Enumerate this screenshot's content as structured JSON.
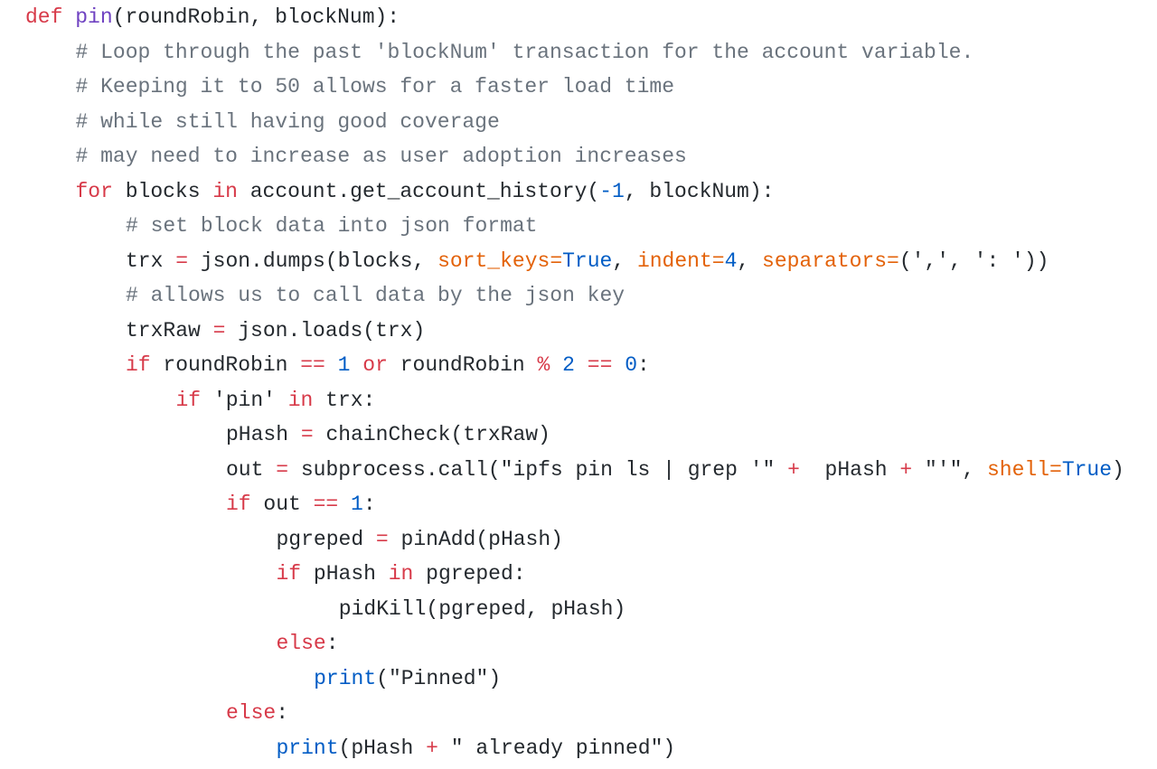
{
  "language": "python",
  "code_lines": [
    {
      "indent": 0,
      "tokens": [
        {
          "t": "def",
          "c": "kw"
        },
        {
          "t": " ",
          "c": "id"
        },
        {
          "t": "pin",
          "c": "fn"
        },
        {
          "t": "(roundRobin, blockNum):",
          "c": "id"
        }
      ]
    },
    {
      "indent": 1,
      "tokens": [
        {
          "t": "# Loop through the past 'blockNum' transaction for the account variable.",
          "c": "cm"
        }
      ]
    },
    {
      "indent": 1,
      "tokens": [
        {
          "t": "# Keeping it to 50 allows for a faster load time",
          "c": "cm"
        }
      ]
    },
    {
      "indent": 1,
      "tokens": [
        {
          "t": "# while still having good coverage",
          "c": "cm"
        }
      ]
    },
    {
      "indent": 1,
      "tokens": [
        {
          "t": "# may need to increase as user adoption increases",
          "c": "cm"
        }
      ]
    },
    {
      "indent": 1,
      "tokens": [
        {
          "t": "for",
          "c": "kw"
        },
        {
          "t": " blocks ",
          "c": "id"
        },
        {
          "t": "in",
          "c": "kw"
        },
        {
          "t": " account.get_account_history(",
          "c": "id"
        },
        {
          "t": "-1",
          "c": "num"
        },
        {
          "t": ", blockNum):",
          "c": "id"
        }
      ]
    },
    {
      "indent": 2,
      "tokens": [
        {
          "t": "# set block data into json format",
          "c": "cm"
        }
      ]
    },
    {
      "indent": 2,
      "tokens": [
        {
          "t": "trx ",
          "c": "id"
        },
        {
          "t": "=",
          "c": "op"
        },
        {
          "t": " json.dumps(blocks, ",
          "c": "id"
        },
        {
          "t": "sort_keys",
          "c": "arg"
        },
        {
          "t": "=",
          "c": "arg"
        },
        {
          "t": "True",
          "c": "bi"
        },
        {
          "t": ", ",
          "c": "id"
        },
        {
          "t": "indent",
          "c": "arg"
        },
        {
          "t": "=",
          "c": "arg"
        },
        {
          "t": "4",
          "c": "num"
        },
        {
          "t": ", ",
          "c": "id"
        },
        {
          "t": "separators",
          "c": "arg"
        },
        {
          "t": "=",
          "c": "arg"
        },
        {
          "t": "(',', ': '))",
          "c": "id"
        }
      ]
    },
    {
      "indent": 2,
      "tokens": [
        {
          "t": "# allows us to call data by the json key",
          "c": "cm"
        }
      ]
    },
    {
      "indent": 2,
      "tokens": [
        {
          "t": "trxRaw ",
          "c": "id"
        },
        {
          "t": "=",
          "c": "op"
        },
        {
          "t": " json.loads(trx)",
          "c": "id"
        }
      ]
    },
    {
      "indent": 2,
      "tokens": [
        {
          "t": "if",
          "c": "kw"
        },
        {
          "t": " roundRobin ",
          "c": "id"
        },
        {
          "t": "==",
          "c": "op"
        },
        {
          "t": " ",
          "c": "id"
        },
        {
          "t": "1",
          "c": "num"
        },
        {
          "t": " ",
          "c": "id"
        },
        {
          "t": "or",
          "c": "kw"
        },
        {
          "t": " roundRobin ",
          "c": "id"
        },
        {
          "t": "%",
          "c": "op"
        },
        {
          "t": " ",
          "c": "id"
        },
        {
          "t": "2",
          "c": "num"
        },
        {
          "t": " ",
          "c": "id"
        },
        {
          "t": "==",
          "c": "op"
        },
        {
          "t": " ",
          "c": "id"
        },
        {
          "t": "0",
          "c": "num"
        },
        {
          "t": ":",
          "c": "id"
        }
      ]
    },
    {
      "indent": 3,
      "tokens": [
        {
          "t": "if",
          "c": "kw"
        },
        {
          "t": " 'pin' ",
          "c": "id"
        },
        {
          "t": "in",
          "c": "kw"
        },
        {
          "t": " trx:",
          "c": "id"
        }
      ]
    },
    {
      "indent": 4,
      "tokens": [
        {
          "t": "pHash ",
          "c": "id"
        },
        {
          "t": "=",
          "c": "op"
        },
        {
          "t": " chainCheck(trxRaw)",
          "c": "id"
        }
      ]
    },
    {
      "indent": 4,
      "tokens": [
        {
          "t": "out ",
          "c": "id"
        },
        {
          "t": "=",
          "c": "op"
        },
        {
          "t": " subprocess.call(\"ipfs pin ls | grep '\" ",
          "c": "id"
        },
        {
          "t": "+",
          "c": "op"
        },
        {
          "t": "  pHash ",
          "c": "id"
        },
        {
          "t": "+",
          "c": "op"
        },
        {
          "t": " \"'\", ",
          "c": "id"
        },
        {
          "t": "shell",
          "c": "arg"
        },
        {
          "t": "=",
          "c": "arg"
        },
        {
          "t": "True",
          "c": "bi"
        },
        {
          "t": ")",
          "c": "id"
        }
      ]
    },
    {
      "indent": 4,
      "tokens": [
        {
          "t": "if",
          "c": "kw"
        },
        {
          "t": " out ",
          "c": "id"
        },
        {
          "t": "==",
          "c": "op"
        },
        {
          "t": " ",
          "c": "id"
        },
        {
          "t": "1",
          "c": "num"
        },
        {
          "t": ":",
          "c": "id"
        }
      ]
    },
    {
      "indent": 5,
      "tokens": [
        {
          "t": "pgreped ",
          "c": "id"
        },
        {
          "t": "=",
          "c": "op"
        },
        {
          "t": " pinAdd(pHash)",
          "c": "id"
        }
      ]
    },
    {
      "indent": 5,
      "tokens": [
        {
          "t": "if",
          "c": "kw"
        },
        {
          "t": " pHash ",
          "c": "id"
        },
        {
          "t": "in",
          "c": "kw"
        },
        {
          "t": " pgreped:",
          "c": "id"
        }
      ]
    },
    {
      "indent": 6,
      "tokens": [
        {
          "t": " pidKill(pgreped, pHash)",
          "c": "id"
        }
      ]
    },
    {
      "indent": 5,
      "tokens": [
        {
          "t": "else",
          "c": "kw"
        },
        {
          "t": ":",
          "c": "id"
        }
      ]
    },
    {
      "indent": 5.75,
      "tokens": [
        {
          "t": "print",
          "c": "bi"
        },
        {
          "t": "(\"Pinned\")",
          "c": "id"
        }
      ]
    },
    {
      "indent": 4,
      "tokens": [
        {
          "t": "else",
          "c": "kw"
        },
        {
          "t": ":",
          "c": "id"
        }
      ]
    },
    {
      "indent": 5,
      "tokens": [
        {
          "t": "print",
          "c": "bi"
        },
        {
          "t": "(pHash ",
          "c": "id"
        },
        {
          "t": "+",
          "c": "op"
        },
        {
          "t": " \" already pinned\")",
          "c": "id"
        }
      ]
    }
  ]
}
